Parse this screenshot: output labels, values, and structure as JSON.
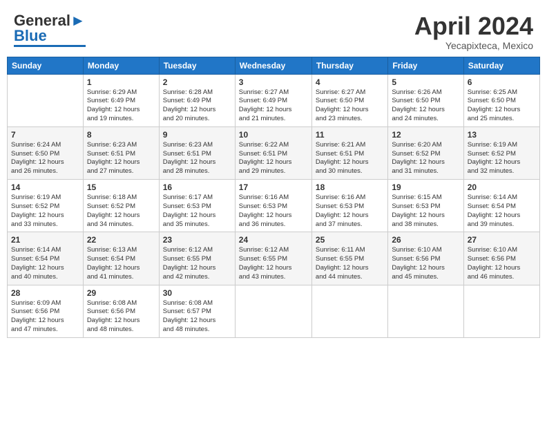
{
  "header": {
    "logo_line1": "General",
    "logo_line2": "Blue",
    "month": "April 2024",
    "location": "Yecapixteca, Mexico"
  },
  "weekdays": [
    "Sunday",
    "Monday",
    "Tuesday",
    "Wednesday",
    "Thursday",
    "Friday",
    "Saturday"
  ],
  "weeks": [
    [
      {
        "day": "",
        "info": ""
      },
      {
        "day": "1",
        "info": "Sunrise: 6:29 AM\nSunset: 6:49 PM\nDaylight: 12 hours\nand 19 minutes."
      },
      {
        "day": "2",
        "info": "Sunrise: 6:28 AM\nSunset: 6:49 PM\nDaylight: 12 hours\nand 20 minutes."
      },
      {
        "day": "3",
        "info": "Sunrise: 6:27 AM\nSunset: 6:49 PM\nDaylight: 12 hours\nand 21 minutes."
      },
      {
        "day": "4",
        "info": "Sunrise: 6:27 AM\nSunset: 6:50 PM\nDaylight: 12 hours\nand 23 minutes."
      },
      {
        "day": "5",
        "info": "Sunrise: 6:26 AM\nSunset: 6:50 PM\nDaylight: 12 hours\nand 24 minutes."
      },
      {
        "day": "6",
        "info": "Sunrise: 6:25 AM\nSunset: 6:50 PM\nDaylight: 12 hours\nand 25 minutes."
      }
    ],
    [
      {
        "day": "7",
        "info": "Sunrise: 6:24 AM\nSunset: 6:50 PM\nDaylight: 12 hours\nand 26 minutes."
      },
      {
        "day": "8",
        "info": "Sunrise: 6:23 AM\nSunset: 6:51 PM\nDaylight: 12 hours\nand 27 minutes."
      },
      {
        "day": "9",
        "info": "Sunrise: 6:23 AM\nSunset: 6:51 PM\nDaylight: 12 hours\nand 28 minutes."
      },
      {
        "day": "10",
        "info": "Sunrise: 6:22 AM\nSunset: 6:51 PM\nDaylight: 12 hours\nand 29 minutes."
      },
      {
        "day": "11",
        "info": "Sunrise: 6:21 AM\nSunset: 6:51 PM\nDaylight: 12 hours\nand 30 minutes."
      },
      {
        "day": "12",
        "info": "Sunrise: 6:20 AM\nSunset: 6:52 PM\nDaylight: 12 hours\nand 31 minutes."
      },
      {
        "day": "13",
        "info": "Sunrise: 6:19 AM\nSunset: 6:52 PM\nDaylight: 12 hours\nand 32 minutes."
      }
    ],
    [
      {
        "day": "14",
        "info": "Sunrise: 6:19 AM\nSunset: 6:52 PM\nDaylight: 12 hours\nand 33 minutes."
      },
      {
        "day": "15",
        "info": "Sunrise: 6:18 AM\nSunset: 6:52 PM\nDaylight: 12 hours\nand 34 minutes."
      },
      {
        "day": "16",
        "info": "Sunrise: 6:17 AM\nSunset: 6:53 PM\nDaylight: 12 hours\nand 35 minutes."
      },
      {
        "day": "17",
        "info": "Sunrise: 6:16 AM\nSunset: 6:53 PM\nDaylight: 12 hours\nand 36 minutes."
      },
      {
        "day": "18",
        "info": "Sunrise: 6:16 AM\nSunset: 6:53 PM\nDaylight: 12 hours\nand 37 minutes."
      },
      {
        "day": "19",
        "info": "Sunrise: 6:15 AM\nSunset: 6:53 PM\nDaylight: 12 hours\nand 38 minutes."
      },
      {
        "day": "20",
        "info": "Sunrise: 6:14 AM\nSunset: 6:54 PM\nDaylight: 12 hours\nand 39 minutes."
      }
    ],
    [
      {
        "day": "21",
        "info": "Sunrise: 6:14 AM\nSunset: 6:54 PM\nDaylight: 12 hours\nand 40 minutes."
      },
      {
        "day": "22",
        "info": "Sunrise: 6:13 AM\nSunset: 6:54 PM\nDaylight: 12 hours\nand 41 minutes."
      },
      {
        "day": "23",
        "info": "Sunrise: 6:12 AM\nSunset: 6:55 PM\nDaylight: 12 hours\nand 42 minutes."
      },
      {
        "day": "24",
        "info": "Sunrise: 6:12 AM\nSunset: 6:55 PM\nDaylight: 12 hours\nand 43 minutes."
      },
      {
        "day": "25",
        "info": "Sunrise: 6:11 AM\nSunset: 6:55 PM\nDaylight: 12 hours\nand 44 minutes."
      },
      {
        "day": "26",
        "info": "Sunrise: 6:10 AM\nSunset: 6:56 PM\nDaylight: 12 hours\nand 45 minutes."
      },
      {
        "day": "27",
        "info": "Sunrise: 6:10 AM\nSunset: 6:56 PM\nDaylight: 12 hours\nand 46 minutes."
      }
    ],
    [
      {
        "day": "28",
        "info": "Sunrise: 6:09 AM\nSunset: 6:56 PM\nDaylight: 12 hours\nand 47 minutes."
      },
      {
        "day": "29",
        "info": "Sunrise: 6:08 AM\nSunset: 6:56 PM\nDaylight: 12 hours\nand 48 minutes."
      },
      {
        "day": "30",
        "info": "Sunrise: 6:08 AM\nSunset: 6:57 PM\nDaylight: 12 hours\nand 48 minutes."
      },
      {
        "day": "",
        "info": ""
      },
      {
        "day": "",
        "info": ""
      },
      {
        "day": "",
        "info": ""
      },
      {
        "day": "",
        "info": ""
      }
    ]
  ]
}
